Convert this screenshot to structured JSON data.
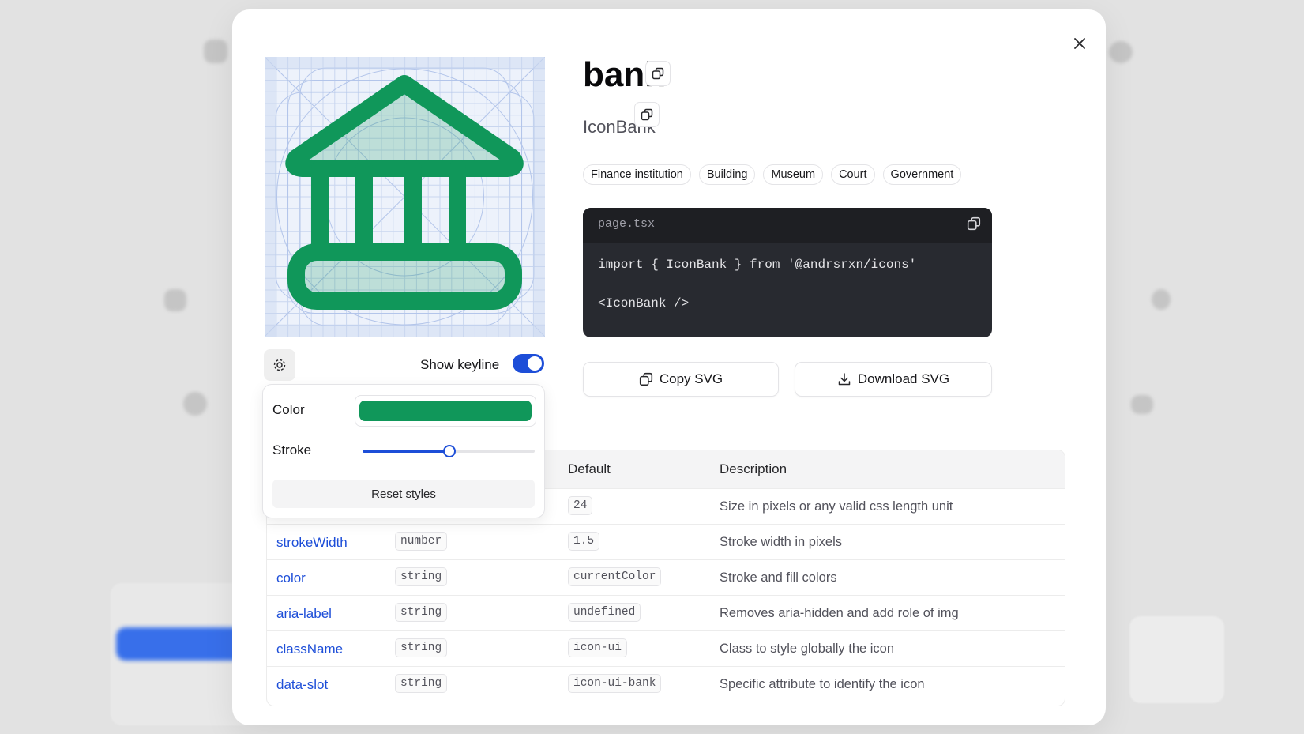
{
  "icon": {
    "title": "bank",
    "component": "IconBank",
    "tags": [
      "Finance institution",
      "Building",
      "Museum",
      "Court",
      "Government"
    ],
    "color": "#10975a"
  },
  "controls": {
    "keyline_label": "Show keyline",
    "keyline_on": true,
    "color_label": "Color",
    "stroke_label": "Stroke",
    "stroke_level": 0.5,
    "reset_label": "Reset styles"
  },
  "code": {
    "filename": "page.tsx",
    "import_line": "import { IconBank } from '@andrsrxn/icons'",
    "usage_line": "<IconBank />"
  },
  "actions": {
    "copy_svg": "Copy SVG",
    "download_svg": "Download SVG"
  },
  "table": {
    "headers": {
      "default": "Default",
      "description": "Description"
    },
    "rows": [
      {
        "name": "",
        "type": "",
        "default": "24",
        "description": "Size in pixels or any valid css length unit"
      },
      {
        "name": "strokeWidth",
        "type": "number",
        "default": "1.5",
        "description": "Stroke width in pixels"
      },
      {
        "name": "color",
        "type": "string",
        "default": "currentColor",
        "description": "Stroke and fill colors"
      },
      {
        "name": "aria-label",
        "type": "string",
        "default": "undefined",
        "description": "Removes aria-hidden and add role of img"
      },
      {
        "name": "className",
        "type": "string",
        "default": "icon-ui",
        "description": "Class to style globally the icon"
      },
      {
        "name": "data-slot",
        "type": "string",
        "default": "icon-ui-bank",
        "description": "Specific attribute to identify the icon"
      }
    ]
  },
  "colors": {
    "accent": "#1d4ed8",
    "icon_green": "#10975a",
    "code_bg": "#282a30"
  }
}
